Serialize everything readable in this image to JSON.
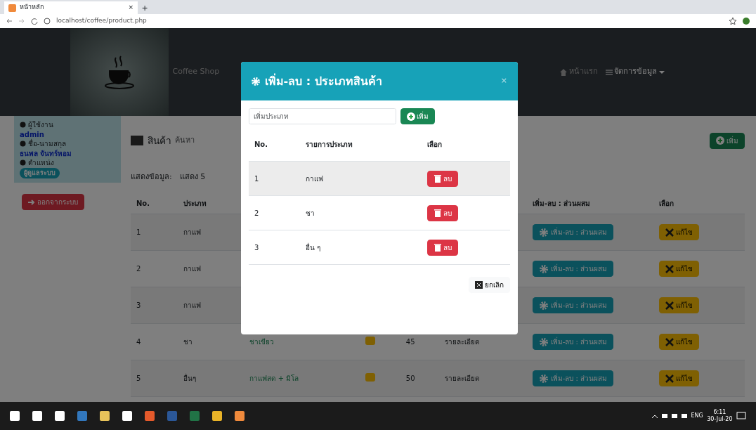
{
  "browser": {
    "tab_title": "หน้าหลัก",
    "tab_close": "×",
    "new_tab": "+",
    "url": "localhost/coffee/product.php"
  },
  "navbar": {
    "brand": "Coffee Shop",
    "links": [
      "หน้าแรก",
      "จัดการข้อมูล"
    ]
  },
  "sidebar": {
    "user_label": "ผู้ใช้งาน",
    "user": "admin",
    "name_label": "ชื่อ-นามสกุล",
    "name": "ธนพล จันทร์หอม",
    "role_label": "ตำแหน่ง",
    "role": "ผู้ดูแลระบบ",
    "logout": "ออกจากระบบ"
  },
  "main": {
    "title": "สินค้า",
    "subtitle": "ค้นหา",
    "add_button": "เพิ่ม",
    "filter_label": "แสดงข้อมูล:",
    "filter_value": "แสดง 5",
    "columns": [
      "No.",
      "ประเภท",
      "",
      "",
      "",
      "",
      "เพิ่ม-ลบ : ส่วนผสม",
      "เลือก"
    ],
    "rows": [
      {
        "no": "1",
        "type": "กาแฟ",
        "mix": "เพิ่ม-ลบ : ส่วนผสม",
        "edit": "แก้ไข"
      },
      {
        "no": "2",
        "type": "กาแฟ",
        "mix": "เพิ่ม-ลบ : ส่วนผสม",
        "edit": "แก้ไข"
      },
      {
        "no": "3",
        "type": "กาแฟ",
        "mix": "เพิ่ม-ลบ : ส่วนผสม",
        "edit": "แก้ไข"
      },
      {
        "no": "4",
        "type": "ชา",
        "name": "ชาเขียว",
        "badge": true,
        "price": "45",
        "detail": "รายละเอียด",
        "mix": "เพิ่ม-ลบ : ส่วนผสม",
        "edit": "แก้ไข"
      },
      {
        "no": "5",
        "type": "อื่นๆ",
        "name": "กาแฟสด + มิโล",
        "badge": true,
        "price": "50",
        "detail": "รายละเอียด",
        "mix": "เพิ่ม-ลบ : ส่วนผสม",
        "edit": "แก้ไข"
      }
    ]
  },
  "modal": {
    "title": "เพิ่ม-ลบ : ประเภทสินค้า",
    "close": "×",
    "placeholder": "เพิ่มประเภท",
    "add_button": "เพิ่ม",
    "columns": [
      "No.",
      "รายการประเภท",
      "เลือก"
    ],
    "rows": [
      {
        "no": "1",
        "name": "กาแฟ",
        "delete": "ลบ",
        "selected": true
      },
      {
        "no": "2",
        "name": "ชา",
        "delete": "ลบ",
        "selected": false
      },
      {
        "no": "3",
        "name": "อื่น ๆ",
        "delete": "ลบ",
        "selected": false
      }
    ],
    "cancel": "ยกเลิก"
  },
  "taskbar": {
    "language": "ENG",
    "time": "6:11",
    "date": "30-Jul-20"
  }
}
